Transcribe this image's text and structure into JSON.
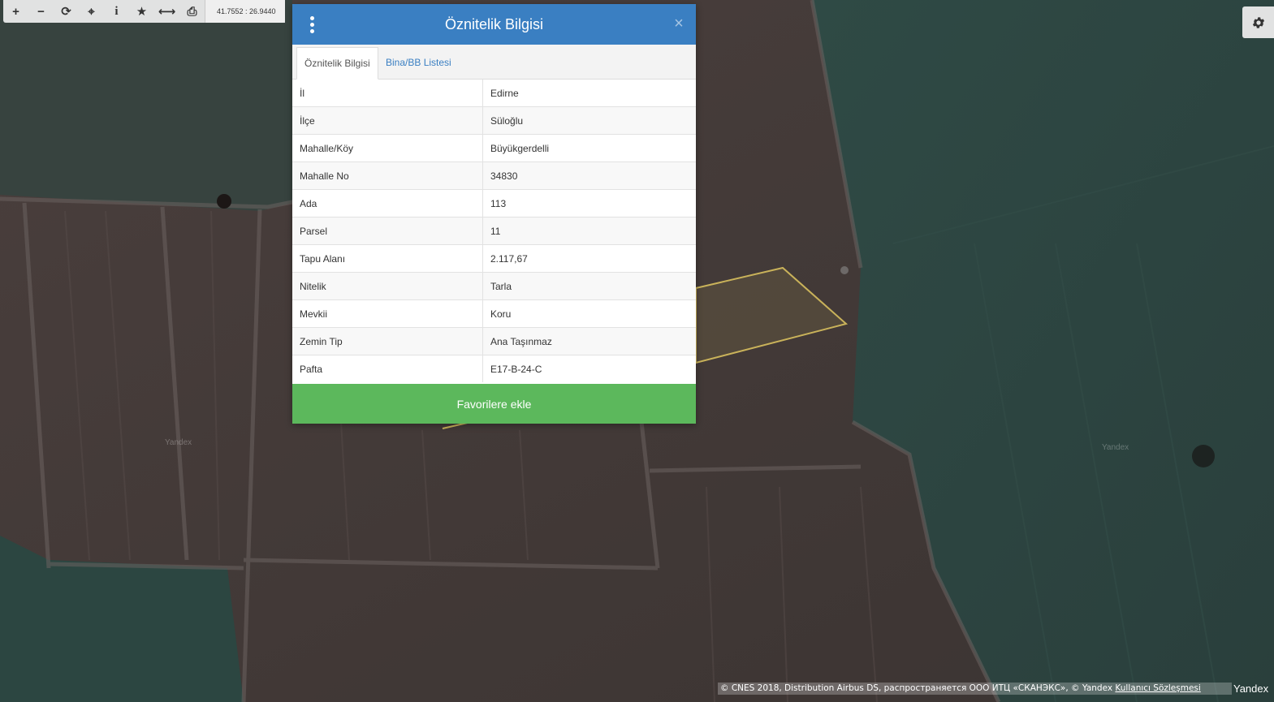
{
  "toolbar": {
    "buttons": [
      {
        "name": "zoom-in",
        "glyph": "+"
      },
      {
        "name": "zoom-out",
        "glyph": "−"
      },
      {
        "name": "refresh",
        "glyph": "⟳"
      },
      {
        "name": "locate",
        "glyph": "⌖"
      },
      {
        "name": "info",
        "glyph": "i"
      },
      {
        "name": "favorite",
        "glyph": "★"
      },
      {
        "name": "measure",
        "glyph": "⟷"
      },
      {
        "name": "print",
        "glyph": "⎙"
      }
    ],
    "coordinates": "41.7552 : 26.9440"
  },
  "dialog": {
    "title": "Öznitelik Bilgisi",
    "close_glyph": "×",
    "tabs": [
      {
        "label": "Öznitelik Bilgisi",
        "active": true
      },
      {
        "label": "Bina/BB Listesi",
        "active": false
      }
    ],
    "rows": [
      {
        "key": "İl",
        "value": "Edirne"
      },
      {
        "key": "İlçe",
        "value": "Süloğlu"
      },
      {
        "key": "Mahalle/Köy",
        "value": "Büyükgerdelli"
      },
      {
        "key": "Mahalle No",
        "value": "34830"
      },
      {
        "key": "Ada",
        "value": "113"
      },
      {
        "key": "Parsel",
        "value": "11"
      },
      {
        "key": "Tapu Alanı",
        "value": "2.117,67"
      },
      {
        "key": "Nitelik",
        "value": "Tarla"
      },
      {
        "key": "Mevkii",
        "value": "Koru"
      },
      {
        "key": "Zemin Tip",
        "value": "Ana Taşınmaz"
      },
      {
        "key": "Pafta",
        "value": "E17-B-24-C"
      }
    ],
    "favorite_button": "Favorilere ekle"
  },
  "map": {
    "watermark": "Yandex",
    "attribution_text": "© CNES 2018, Distribution Airbus DS, распространяется ООО ИТЦ «СКАНЭКС», © Yandex ",
    "attribution_link": "Kullanıcı Sözleşmesi",
    "logo": "Yandex",
    "parcel_color": "#c9b25a"
  },
  "icons": {
    "settings": "gear-icon",
    "menu": "kebab-menu-icon",
    "close": "close-icon"
  }
}
